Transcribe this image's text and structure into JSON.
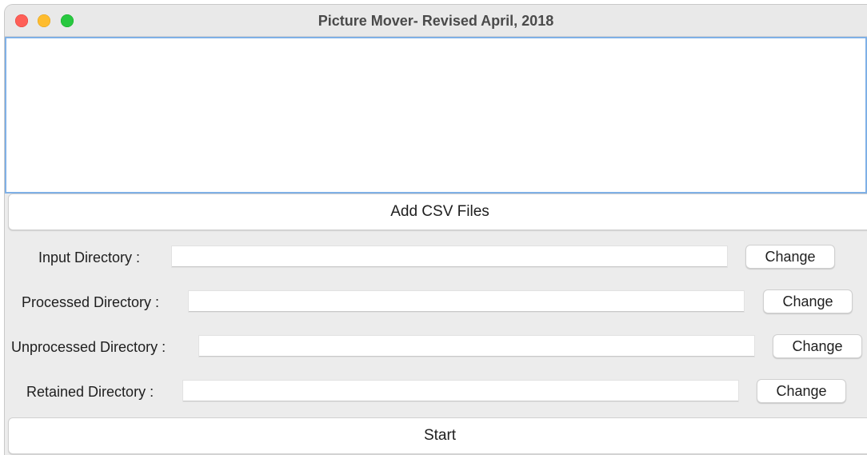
{
  "window": {
    "title": "Picture Mover- Revised April, 2018"
  },
  "buttons": {
    "add_csv": "Add CSV Files",
    "start": "Start",
    "change": "Change"
  },
  "directories": {
    "input": {
      "label": "Input Directory :",
      "value": ""
    },
    "processed": {
      "label": "Processed Directory :",
      "value": ""
    },
    "unprocessed": {
      "label": "Unprocessed Directory :",
      "value": ""
    },
    "retained": {
      "label": "Retained Directory :",
      "value": ""
    }
  },
  "colors": {
    "close": "#fe5f57",
    "minimize": "#febc2e",
    "maximize": "#28c840",
    "list_focus_border": "#7fb0e6"
  }
}
